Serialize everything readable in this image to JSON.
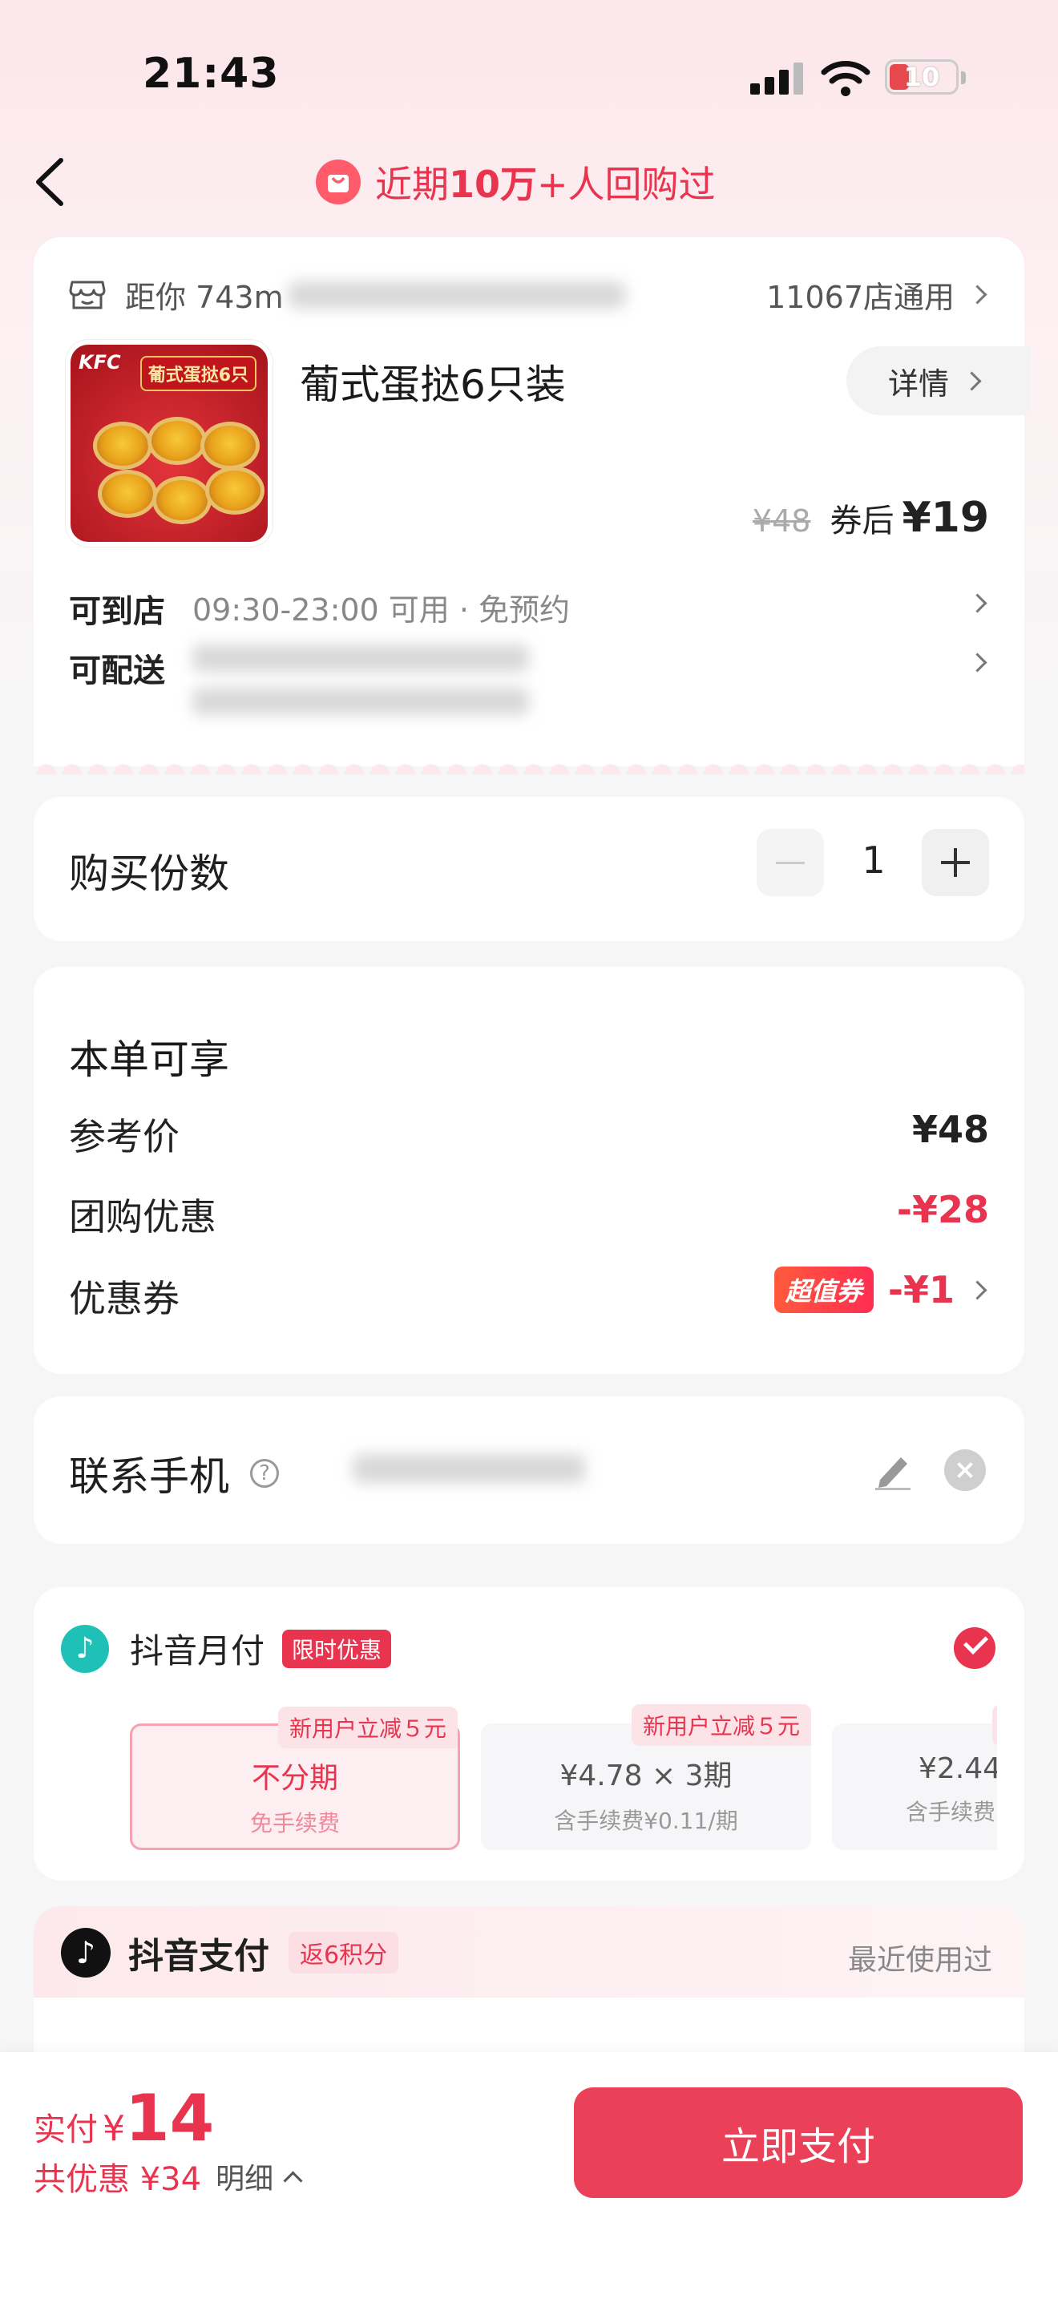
{
  "status": {
    "time": "21:43",
    "battery": "10"
  },
  "header": {
    "title_prefix": "近期",
    "title_bold": "10万",
    "title_suffix": "+人回购过"
  },
  "store": {
    "distance": "距你 743m",
    "stores_count": "11067店通用"
  },
  "product": {
    "name": "葡式蛋挞6只装",
    "detail_label": "详情",
    "original_price": "¥48",
    "after_coupon_label": "券后",
    "after_coupon_price": "¥19",
    "image_brand": "KFC",
    "image_title": "葡式蛋挞6只"
  },
  "rows": {
    "instore_label": "可到店",
    "instore_value": "09:30-23:00 可用 · 免预约",
    "delivery_label": "可配送"
  },
  "quantity": {
    "label": "购买份数",
    "value": "1"
  },
  "benefits": {
    "title": "本单可享",
    "items": [
      {
        "label": "参考价",
        "value": "¥48"
      },
      {
        "label": "团购优惠",
        "value": "-¥28"
      },
      {
        "label": "优惠券",
        "badge": "超值券",
        "value": "-¥1"
      }
    ]
  },
  "contact": {
    "label": "联系手机"
  },
  "monthly_pay": {
    "title": "抖音月付",
    "tag": "限时优惠",
    "options": [
      {
        "tag": "新用户立减５元",
        "title": "不分期",
        "sub": "免手续费"
      },
      {
        "tag": "新用户立减５元",
        "title": "¥4.78 × 3期",
        "sub": "含手续费¥0.11/期"
      },
      {
        "tag": "新",
        "title": "¥2.44",
        "sub": "含手续费"
      }
    ]
  },
  "douyin_pay": {
    "title": "抖音支付",
    "points": "返6积分",
    "recent": "最近使用过"
  },
  "bottom": {
    "pay_label": "实付",
    "pay_currency": "¥",
    "pay_amount": "14",
    "discount": "共优惠 ¥34",
    "detail": "明细",
    "button": "立即支付"
  },
  "colors": {
    "accent": "#e8344e",
    "button": "#ea4058"
  }
}
